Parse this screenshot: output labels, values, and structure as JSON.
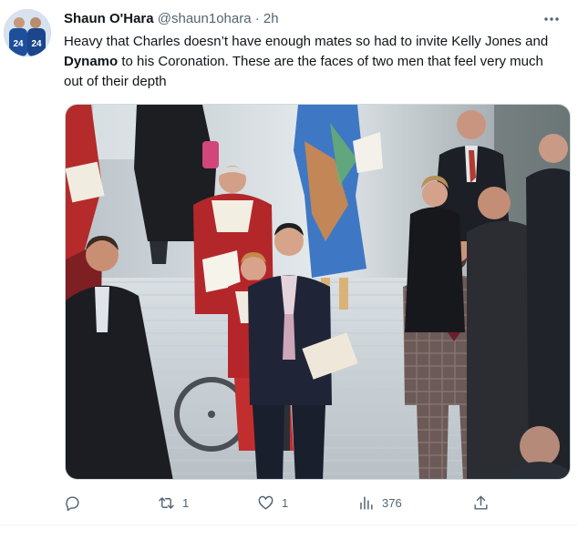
{
  "tweet": {
    "display_name": "Shaun O'Hara",
    "handle": "@shaun1ohara",
    "separator": "·",
    "time": "2h",
    "text_part1": "Heavy that Charles doesn’t have enough mates so had to invite Kelly Jones and ",
    "text_bold": "Dynamo",
    "text_part2": " to his Coronation. These are the faces of two men that feel very much out of their depth"
  },
  "avatar": {
    "jersey_numbers": [
      "24",
      "24"
    ]
  },
  "icons": {
    "more": "more-horizontal-icon",
    "reply": "reply-icon",
    "retweet": "retweet-icon",
    "like": "heart-icon",
    "views": "views-bar-chart-icon",
    "share": "share-icon"
  },
  "actions": {
    "reply_count": "",
    "retweet_count": "1",
    "like_count": "1",
    "view_count": "376"
  },
  "colors": {
    "text": "#0f1419",
    "muted": "#536471",
    "border": "#cfd9de"
  }
}
